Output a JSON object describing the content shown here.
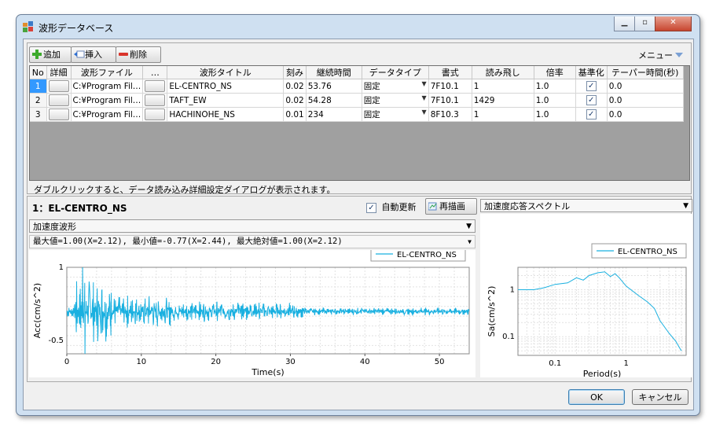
{
  "window": {
    "title": "波形データベース"
  },
  "toolbar": {
    "add_label": "追加",
    "insert_label": "挿入",
    "delete_label": "削除",
    "menu_label": "メニュー"
  },
  "table": {
    "columns": [
      "No",
      "詳細",
      "波形ファイル",
      "…",
      "波形タイトル",
      "刻み",
      "継続時間",
      "データタイプ",
      "書式",
      "読み飛し",
      "倍率",
      "基準化",
      "テーパー時間(秒)"
    ],
    "rows": [
      {
        "no": "1",
        "file": "C:¥Program Fil…",
        "title": "EL-CENTRO_NS",
        "dt": "0.02",
        "duration": "53.76",
        "dtype": "固定",
        "format": "7F10.1",
        "skip": "1",
        "scale": "1.0",
        "normalize": true,
        "taper": "0.0"
      },
      {
        "no": "2",
        "file": "C:¥Program Fil…",
        "title": "TAFT_EW",
        "dt": "0.02",
        "duration": "54.28",
        "dtype": "固定",
        "format": "7F10.1",
        "skip": "1429",
        "scale": "1.0",
        "normalize": true,
        "taper": "0.0"
      },
      {
        "no": "3",
        "file": "C:¥Program Fil…",
        "title": "HACHINOHE_NS",
        "dt": "0.01",
        "duration": "234",
        "dtype": "固定",
        "format": "8F10.3",
        "skip": "1",
        "scale": "1.0",
        "normalize": true,
        "taper": "0.0"
      }
    ]
  },
  "hint_text": "ダブルクリックすると、データ読み込み詳細設定ダイアログが表示されます。",
  "detail": {
    "header": "1：EL-CENTRO_NS",
    "auto_update_label": "自動更新",
    "auto_update_checked": true,
    "redraw_label": "再描画",
    "spectrum_select": "加速度応答スペクトル",
    "wave_select": "加速度波形",
    "stats": "最大値=1.00(X=2.12), 最小値=-0.77(X=2.44), 最大絶対値=1.00(X=2.12)"
  },
  "buttons": {
    "ok": "OK",
    "cancel": "キャンセル"
  },
  "colors": {
    "series": "#19b0e0",
    "selection": "#3399ff"
  },
  "chart_data": [
    {
      "type": "line",
      "legend": "EL-CENTRO_NS",
      "xlabel": "Time(s)",
      "ylabel": "Acc(cm/s^2)",
      "xlim": [
        0,
        54
      ],
      "ylim": [
        -0.77,
        1.0
      ],
      "xticks": [
        "0",
        "10",
        "20",
        "30",
        "40",
        "50"
      ],
      "yticks": [
        "1",
        "-0.5"
      ],
      "peak": {
        "max": 1.0,
        "max_x": 2.12,
        "min": -0.77,
        "min_x": 2.44
      },
      "grid": true
    },
    {
      "type": "line",
      "legend": "EL-CENTRO_NS",
      "xlabel": "Period(s)",
      "ylabel": "Sa(cm/s^2)",
      "xscale": "log",
      "yscale": "log",
      "xticks": [
        "0.1",
        "1"
      ],
      "yticks": [
        "1",
        "0.1"
      ],
      "x": [
        0.03,
        0.05,
        0.07,
        0.1,
        0.15,
        0.2,
        0.25,
        0.3,
        0.4,
        0.5,
        0.6,
        0.7,
        0.8,
        1.0,
        1.5,
        2.0,
        2.5,
        3.0,
        4.0,
        5.0,
        6.0
      ],
      "y": [
        1.0,
        1.0,
        1.1,
        1.3,
        1.4,
        1.8,
        1.6,
        2.0,
        2.3,
        2.4,
        1.9,
        2.2,
        1.8,
        1.2,
        0.75,
        0.55,
        0.4,
        0.22,
        0.12,
        0.08,
        0.05
      ],
      "grid": true
    }
  ]
}
